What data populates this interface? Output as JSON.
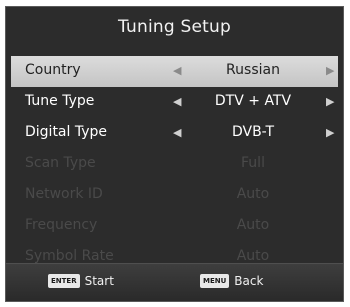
{
  "title": "Tuning Setup",
  "rows": [
    {
      "label": "Country",
      "value": "Russian"
    },
    {
      "label": "Tune Type",
      "value": "DTV + ATV"
    },
    {
      "label": "Digital Type",
      "value": "DVB-T"
    },
    {
      "label": "Scan Type",
      "value": "Full"
    },
    {
      "label": "Network ID",
      "value": "Auto"
    },
    {
      "label": "Frequency",
      "value": "Auto"
    },
    {
      "label": "Symbol Rate",
      "value": "Auto"
    }
  ],
  "footer": {
    "enter_key": "ENTER",
    "enter_label": "Start",
    "menu_key": "MENU",
    "menu_label": "Back"
  },
  "icons": {
    "left_arrow": "left-triangle-arrow",
    "right_arrow": "right-triangle-arrow"
  },
  "colors": {
    "panel_bg": "#2c2c2c",
    "selected_bg": "#d0d0d0",
    "text": "#ffffff",
    "disabled_text": "#4a4a4a"
  }
}
